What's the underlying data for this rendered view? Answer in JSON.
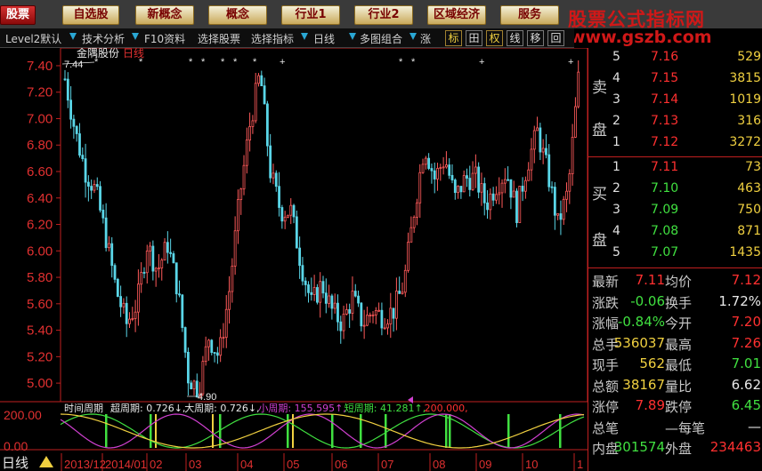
{
  "topbar": {
    "buttons": [
      "股票",
      "自选股",
      "新概念",
      "概念",
      "行业1",
      "行业2",
      "区域经济",
      "服务"
    ],
    "watermark_title": "股票公式指标网",
    "watermark_url": "www.gszb.com"
  },
  "toolbar": {
    "items": [
      "Level2默认",
      "技术分析",
      "F10资料",
      "选择股票",
      "选择指标",
      "日线",
      "多图组合",
      "涨"
    ],
    "buttons": [
      "标",
      "田",
      "权",
      "线",
      "移",
      "回"
    ]
  },
  "chart": {
    "stock_name": "金隅股份",
    "period": "日线",
    "high_marker": "7.44",
    "low_marker": "4.90",
    "indicator_line": {
      "name": "时间周期",
      "items": [
        {
          "label": "超周期: 0.726↓,",
          "color": "#e8e8e8"
        },
        {
          "label": "大周期: 0.726↓,",
          "color": "#e8e8e8"
        },
        {
          "label": "小周期: 155.595↑,",
          "color": "#d040d0"
        },
        {
          "label": "短周期: 41.281↑,",
          "color": "#40e040"
        },
        {
          "label": "200.000,",
          "color": "#ff3030"
        }
      ]
    },
    "indicator_y_labels": [
      "200.00",
      "0.00"
    ],
    "bottom_left_label": "日线",
    "colors": {
      "up": "#ff5a5a",
      "down": "#5ad6e8",
      "axis": "#c02020",
      "grid": "#6a0a0a"
    }
  },
  "chart_data": {
    "type": "candlestick",
    "y_ticks": [
      "7.40",
      "7.20",
      "7.00",
      "6.80",
      "6.60",
      "6.40",
      "6.20",
      "6.00",
      "5.80",
      "5.60",
      "5.40",
      "5.20",
      "5.00"
    ],
    "x_ticks": [
      "2013/12",
      "2014/01",
      "02",
      "03",
      "04",
      "05",
      "06",
      "07",
      "08",
      "09",
      "10",
      "1"
    ],
    "ylim": [
      4.9,
      7.44
    ],
    "high": 7.44,
    "low": 4.9,
    "price_path": [
      7.3,
      6.9,
      6.6,
      6.45,
      6.1,
      5.7,
      5.45,
      5.6,
      6.05,
      5.85,
      6.05,
      5.7,
      5.05,
      4.95,
      5.35,
      5.2,
      5.7,
      6.4,
      6.95,
      7.35,
      6.6,
      6.3,
      6.3,
      5.9,
      5.6,
      5.75,
      5.55,
      5.45,
      5.65,
      5.45,
      5.55,
      5.5,
      5.55,
      5.75,
      6.3,
      6.8,
      6.55,
      6.7,
      6.4,
      6.55,
      6.55,
      6.35,
      6.5,
      6.6,
      6.3,
      6.65,
      6.9,
      6.6,
      6.2,
      6.45,
      7.3
    ]
  },
  "orderbook": {
    "sell_label": [
      "卖",
      "盘"
    ],
    "buy_label": [
      "买",
      "盘"
    ],
    "sell": [
      {
        "level": "5",
        "price": "7.16",
        "vol": "529"
      },
      {
        "level": "4",
        "price": "7.15",
        "vol": "3815"
      },
      {
        "level": "3",
        "price": "7.14",
        "vol": "1019"
      },
      {
        "level": "2",
        "price": "7.13",
        "vol": "316"
      },
      {
        "level": "1",
        "price": "7.12",
        "vol": "3272"
      }
    ],
    "buy": [
      {
        "level": "1",
        "price": "7.11",
        "vol": "73"
      },
      {
        "level": "2",
        "price": "7.10",
        "vol": "463"
      },
      {
        "level": "3",
        "price": "7.09",
        "vol": "750"
      },
      {
        "level": "4",
        "price": "7.08",
        "vol": "871"
      },
      {
        "level": "5",
        "price": "7.07",
        "vol": "1435"
      }
    ]
  },
  "quote": [
    {
      "l1": "最新",
      "v1": "7.11",
      "c1": "red",
      "l2": "均价",
      "v2": "7.12",
      "c2": "red"
    },
    {
      "l1": "涨跌",
      "v1": "-0.06",
      "c1": "green",
      "l2": "换手",
      "v2": "1.72%",
      "c2": "white"
    },
    {
      "l1": "涨幅",
      "v1": "-0.84%",
      "c1": "green",
      "l2": "今开",
      "v2": "7.20",
      "c2": "red"
    },
    {
      "l1": "总手",
      "v1": "536037",
      "c1": "yellow",
      "l2": "最高",
      "v2": "7.26",
      "c2": "red"
    },
    {
      "l1": "现手",
      "v1": "562",
      "c1": "yellow",
      "l2": "最低",
      "v2": "7.01",
      "c2": "green"
    },
    {
      "l1": "总额",
      "v1": "38167",
      "c1": "yellow",
      "l2": "量比",
      "v2": "6.62",
      "c2": "white"
    },
    {
      "l1": "涨停",
      "v1": "7.89",
      "c1": "red",
      "l2": "跌停",
      "v2": "6.45",
      "c2": "green"
    },
    {
      "l1": "总笔",
      "v1": "",
      "c1": "white",
      "l2": "—每笔",
      "v2": "—",
      "c2": "white"
    },
    {
      "l1": "内盘",
      "v1": "301574",
      "c1": "green",
      "l2": "外盘",
      "v2": "234463",
      "c2": "red"
    }
  ]
}
